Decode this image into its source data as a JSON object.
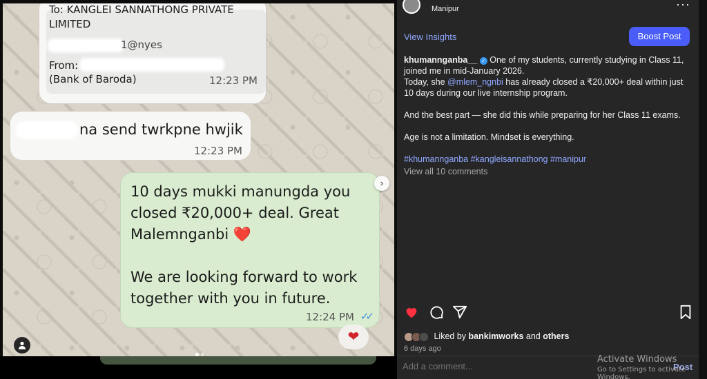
{
  "media": {
    "msg1": {
      "to": "To: KANGLEI SANNATHONG PRIVATE LIMITED",
      "masked_upi": "1@nyes",
      "from": "From:",
      "bank": "(Bank of Baroda)",
      "time": "12:23 PM"
    },
    "msg2": {
      "text": "na send twrkpne hwjik",
      "time": "12:23 PM"
    },
    "msg3": {
      "text": "10 days mukki manungda you closed ₹20,000+ deal. Great Malemnganbi ❤️\n\nWe are looking forward to work together with you in future.",
      "time": "12:24 PM",
      "ticks": "✓✓"
    },
    "reaction": "❤",
    "next_icon": "›"
  },
  "post": {
    "location": "Manipur",
    "more_label": "···",
    "view_insights": "View Insights",
    "boost_label": "Boost Post",
    "username": "khumannganba__",
    "caption_p1": "One of my students, currently studying in Class 11, joined me in mid-January 2026.",
    "caption_p2a": "Today, she ",
    "mention": "@mlem_ngnbi",
    "caption_p2b": " has already closed a ₹20,000+ deal within just 10 days during our live internship program.",
    "caption_p3": "And the best part — she did this while preparing for her Class 11 exams.",
    "caption_p4": "Age is not a limitation. Mindset is everything.",
    "hashtags": "#khumannganba #kangleisannathong #manipur",
    "view_comments": "View all 10 comments",
    "likes_prefix": "Liked by ",
    "likes_user": "bankimworks",
    "likes_and": " and ",
    "likes_others": "others",
    "age": "6 days ago",
    "add_comment_placeholder": "Add a comment...",
    "post_label": "Post"
  },
  "watermark": {
    "line1": "Activate Windows",
    "line2": "Go to Settings to activate Windows."
  },
  "colors": {
    "panel_bg": "#262626",
    "link_blue": "#8fa7ff",
    "boost_blue": "#4a5df9",
    "like_red": "#ff3040",
    "sent_bubble": "#d9eccf"
  }
}
